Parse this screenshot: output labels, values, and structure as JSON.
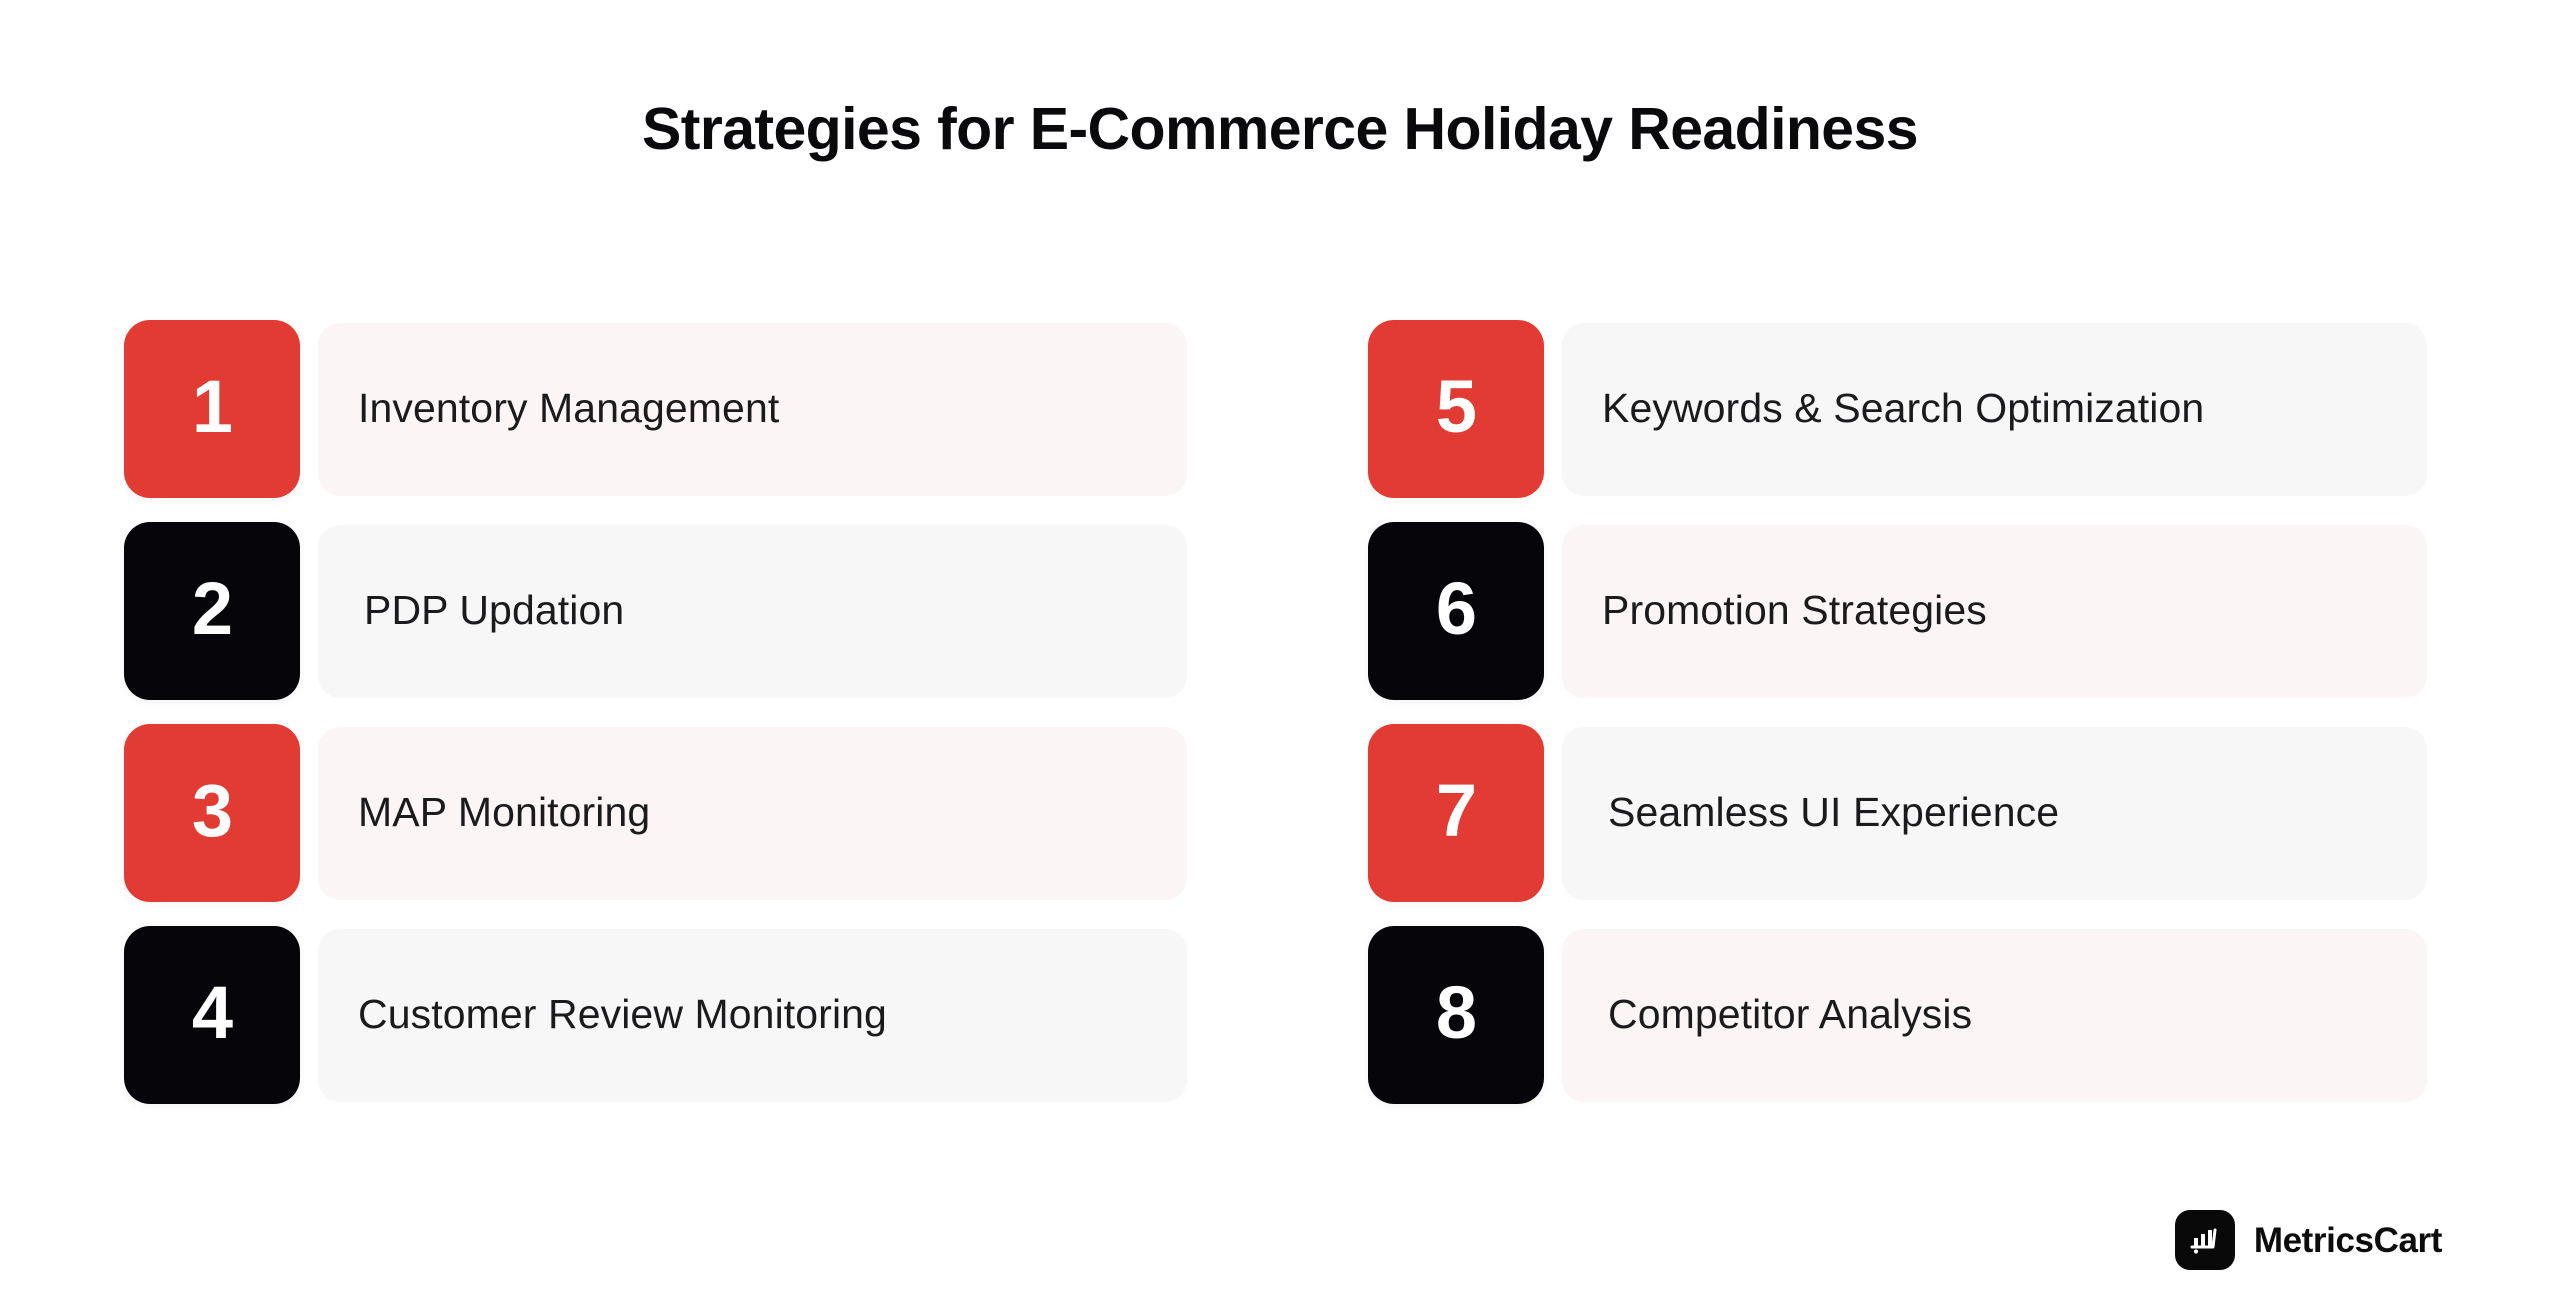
{
  "page": {
    "title": "Strategies for E-Commerce Holiday Readiness",
    "background_color": "#FFFFFF"
  },
  "colors": {
    "accent_red": "#E23B33",
    "accent_black": "#06060A",
    "card_warm": "#FBF6F5",
    "card_neutral": "#F7F7F7",
    "title_text": "#0A0A0D",
    "label_text": "#1B1B1E",
    "badge_number_text": "#FFFFFF"
  },
  "columns": {
    "left": {
      "items": [
        {
          "number": "1",
          "label": "Inventory Management",
          "badge_color": "red",
          "card_tone": "warm"
        },
        {
          "number": "2",
          "label": "PDP Updation",
          "badge_color": "black",
          "card_tone": "neutral"
        },
        {
          "number": "3",
          "label": "MAP Monitoring",
          "badge_color": "red",
          "card_tone": "warm"
        },
        {
          "number": "4",
          "label": "Customer Review Monitoring",
          "badge_color": "black",
          "card_tone": "neutral"
        }
      ]
    },
    "right": {
      "items": [
        {
          "number": "5",
          "label": "Keywords & Search Optimization",
          "badge_color": "red",
          "card_tone": "neutral"
        },
        {
          "number": "6",
          "label": "Promotion Strategies",
          "badge_color": "black",
          "card_tone": "warm"
        },
        {
          "number": "7",
          "label": "Seamless UI Experience",
          "badge_color": "red",
          "card_tone": "neutral"
        },
        {
          "number": "8",
          "label": "Competitor Analysis",
          "badge_color": "black",
          "card_tone": "warm"
        }
      ]
    }
  },
  "logo": {
    "text": "MetricsCart",
    "icon": "bar-chart-cart-icon",
    "mark_background": "#090909",
    "mark_glyph_color": "#FFFFFF"
  }
}
